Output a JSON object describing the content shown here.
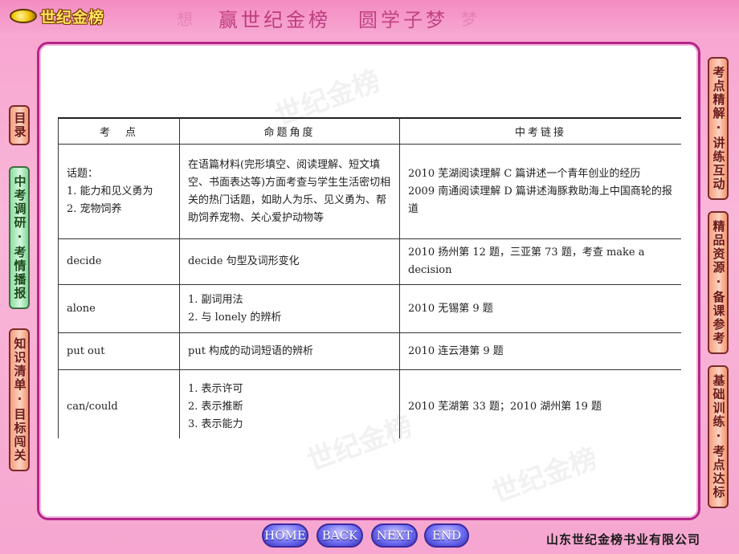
{
  "header": {
    "logo_text": "世纪金榜",
    "slogan": [
      "想",
      "赢世纪金榜",
      "圆学子梦",
      "梦"
    ]
  },
  "sidebar_left": [
    {
      "label": "目录",
      "color": "orange"
    },
    {
      "label": "中考调研·考情播报",
      "color": "green"
    },
    {
      "label": "知识清单·目标闯关",
      "color": "orange"
    }
  ],
  "sidebar_right": [
    {
      "label": "考点精解·讲练互动"
    },
    {
      "label": "精品资源·备课参考"
    },
    {
      "label": "基础训练·考点达标"
    }
  ],
  "watermark_text": "世纪金榜",
  "table": {
    "headers": [
      "考　点",
      "命题角度",
      "中考链接"
    ],
    "rows": [
      {
        "point": [
          "话题：",
          "1. 能力和见义勇为",
          "2. 宠物饲养"
        ],
        "angle": [
          "在语篇材料(完形填空、阅读理解、短文填空、书面表达等)方面考查与学生生活密切相关的热门话题，如助人为乐、见义勇为、帮助饲养宠物、关心爱护动物等"
        ],
        "link": [
          "2010 芜湖阅读理解 C 篇讲述一个青年创业的经历",
          "2009 南通阅读理解 D 篇讲述海豚救助海上中国商轮的报道"
        ]
      },
      {
        "point": [
          "decide"
        ],
        "angle": [
          "decide 句型及词形变化"
        ],
        "link": [
          "2010 扬州第 12 题，三亚第 73 题，考查 make a decision"
        ]
      },
      {
        "point": [
          "alone"
        ],
        "angle": [
          "1. 副词用法",
          "2. 与 lonely 的辨析"
        ],
        "link": [
          "2010 无锡第 9 题"
        ]
      },
      {
        "point": [
          "put out"
        ],
        "angle": [
          "put 构成的动词短语的辨析"
        ],
        "link": [
          "2010 连云港第 9 题"
        ]
      },
      {
        "point": [
          "can/could"
        ],
        "angle": [
          "1. 表示许可",
          "2. 表示推断",
          "3. 表示能力"
        ],
        "link": [
          "2010 芜湖第 33 题；2010 湖州第 19 题"
        ]
      }
    ]
  },
  "nav": [
    "HOME",
    "BACK",
    "NEXT",
    "END"
  ],
  "footer": {
    "company": "山东世纪金榜书业有限公司"
  }
}
